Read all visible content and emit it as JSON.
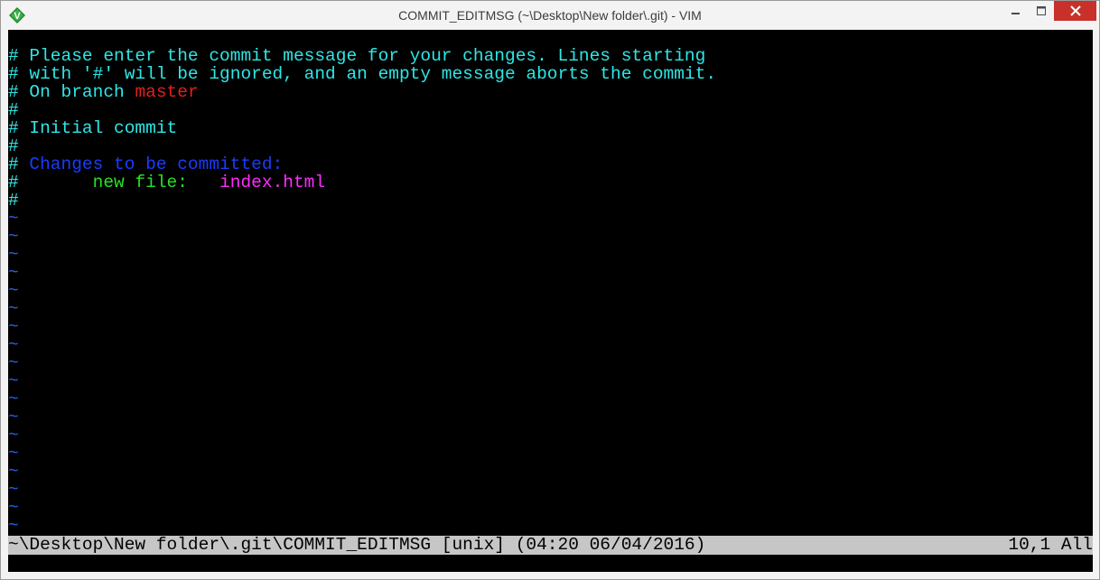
{
  "window": {
    "title": "COMMIT_EDITMSG (~\\Desktop\\New folder\\.git) - VIM",
    "icon": "vim-icon"
  },
  "editor": {
    "lines": [
      {
        "segments": [
          {
            "text": "# Please enter the commit message for your changes. Lines starting",
            "color": "cyan"
          }
        ]
      },
      {
        "segments": [
          {
            "text": "# with '#' will be ignored, and an empty message aborts the commit.",
            "color": "cyan"
          }
        ]
      },
      {
        "segments": [
          {
            "text": "# On branch ",
            "color": "cyan"
          },
          {
            "text": "master",
            "color": "red"
          }
        ]
      },
      {
        "segments": [
          {
            "text": "#",
            "color": "cyan"
          }
        ]
      },
      {
        "segments": [
          {
            "text": "# Initial commit",
            "color": "cyan"
          }
        ]
      },
      {
        "segments": [
          {
            "text": "#",
            "color": "cyan"
          }
        ]
      },
      {
        "segments": [
          {
            "text": "# ",
            "color": "cyan"
          },
          {
            "text": "Changes to be committed:",
            "color": "blue"
          }
        ]
      },
      {
        "segments": [
          {
            "text": "#       ",
            "color": "cyan"
          },
          {
            "text": "new file:",
            "color": "green"
          },
          {
            "text": "   ",
            "color": "cyan"
          },
          {
            "text": "index.html",
            "color": "magenta"
          }
        ]
      },
      {
        "segments": [
          {
            "text": "#",
            "color": "cyan"
          }
        ]
      }
    ],
    "empty_line_marker": "~",
    "empty_line_count": 18
  },
  "statusline": {
    "file_info": "~\\Desktop\\New folder\\.git\\COMMIT_EDITMSG [unix] (04:20 06/04/2016)",
    "position": "10,1 All"
  },
  "colors": {
    "cyan": "#2ee6e6",
    "red": "#e02020",
    "blue": "#1a3cff",
    "green": "#28e028",
    "magenta": "#ff2bff",
    "tilde": "#2464f0",
    "close_button": "#c7312a"
  }
}
